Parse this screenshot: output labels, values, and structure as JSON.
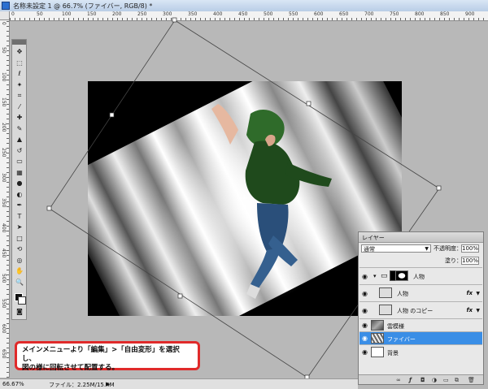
{
  "window": {
    "title": "名称未設定 1 @ 66.7% (ファイバー, RGB/8) *"
  },
  "ruler": {
    "h_ticks": [
      "0",
      "50",
      "100",
      "150",
      "200",
      "250",
      "300",
      "350",
      "400",
      "450",
      "500",
      "550",
      "600",
      "650",
      "700",
      "750",
      "800",
      "850",
      "900"
    ],
    "v_ticks": [
      "0",
      "50",
      "100",
      "150",
      "200",
      "250",
      "300",
      "350",
      "400",
      "450",
      "500",
      "550",
      "600",
      "650"
    ]
  },
  "tools": [
    {
      "name": "move-tool-icon",
      "glyph": "✥"
    },
    {
      "name": "marquee-tool-icon",
      "glyph": "⬚"
    },
    {
      "name": "lasso-tool-icon",
      "glyph": "ℓ"
    },
    {
      "name": "magic-wand-tool-icon",
      "glyph": "✦"
    },
    {
      "name": "crop-tool-icon",
      "glyph": "⌗"
    },
    {
      "name": "eyedropper-tool-icon",
      "glyph": "⁄"
    },
    {
      "name": "healing-brush-tool-icon",
      "glyph": "✚"
    },
    {
      "name": "brush-tool-icon",
      "glyph": "✎"
    },
    {
      "name": "clone-stamp-tool-icon",
      "glyph": "▲"
    },
    {
      "name": "history-brush-tool-icon",
      "glyph": "↺"
    },
    {
      "name": "eraser-tool-icon",
      "glyph": "▭"
    },
    {
      "name": "gradient-tool-icon",
      "glyph": "▦"
    },
    {
      "name": "blur-tool-icon",
      "glyph": "●"
    },
    {
      "name": "dodge-tool-icon",
      "glyph": "◐"
    },
    {
      "name": "pen-tool-icon",
      "glyph": "✒"
    },
    {
      "name": "type-tool-icon",
      "glyph": "T"
    },
    {
      "name": "path-selection-tool-icon",
      "glyph": "➤"
    },
    {
      "name": "shape-tool-icon",
      "glyph": "□"
    },
    {
      "name": "3d-rotate-tool-icon",
      "glyph": "⟲"
    },
    {
      "name": "3d-camera-tool-icon",
      "glyph": "◎"
    },
    {
      "name": "hand-tool-icon",
      "glyph": "✋"
    },
    {
      "name": "zoom-tool-icon",
      "glyph": "🔍"
    }
  ],
  "layers_panel": {
    "tab": "レイヤー",
    "blend_mode": "通常",
    "opacity_label": "不透明度：",
    "opacity_value": "100%",
    "fill_label": "塗り：",
    "fill_value": "100%",
    "layers": [
      {
        "name": "人物",
        "kind": "group"
      },
      {
        "name": "人物",
        "kind": "layer",
        "fx": "fx"
      },
      {
        "name": "人物 のコピー",
        "kind": "layer",
        "fx": "fx"
      },
      {
        "name": "雲模様",
        "kind": "layer"
      },
      {
        "name": "ファイバー",
        "kind": "layer",
        "selected": true
      },
      {
        "name": "背景",
        "kind": "layer"
      }
    ]
  },
  "status": {
    "zoom": "66.67%",
    "doc": "ファイル：2.25M/15.4M",
    "arrow": "▶"
  },
  "note": {
    "line1": "メインメニューより「編集」>「自由変形」を選択し、",
    "line2": "図の様に回転させて配置する。"
  },
  "colors": {
    "selected_row": "#3a8ee6",
    "note_border": "#e02a2a",
    "jacket": "#2f6b2a"
  }
}
